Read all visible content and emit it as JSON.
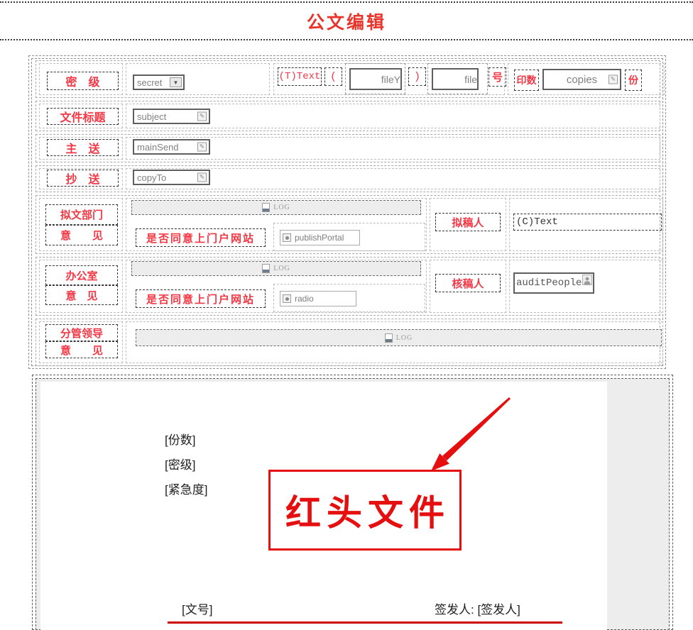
{
  "header": {
    "title": "公文编辑"
  },
  "form": {
    "secret": {
      "label": "密　级",
      "value": "secret"
    },
    "file_number": {
      "t_text": "(T)Text",
      "open_paren": "(",
      "year_value": "fileY",
      "close_paren": ")",
      "no_value": "file",
      "suffix": "号"
    },
    "print_count": {
      "label": "印数",
      "value": "copies",
      "unit": "份"
    },
    "subject": {
      "label": "文件标题",
      "value": "subject"
    },
    "main_send": {
      "label": "主　送",
      "value": "mainSend"
    },
    "copy_to": {
      "label": "抄　送",
      "value": "copyTo"
    },
    "draft_dept": {
      "label_line1": "拟文部门",
      "label_line2": "意　　见",
      "log": "LOG",
      "portal_question": "是否同意上门户网站",
      "portal_value": "publishPortal"
    },
    "drafter": {
      "label": "拟稿人",
      "value": "(C)Text"
    },
    "office": {
      "label_line1": "办公室",
      "label_line2": "意　见",
      "log": "LOG",
      "portal_question": "是否同意上门户网站",
      "portal_value": "radio"
    },
    "auditor": {
      "label": "核稿人",
      "value": "auditPeople"
    },
    "leader": {
      "label_line1": "分管领导",
      "label_line2": "意　　见",
      "log": "LOG"
    }
  },
  "preview": {
    "copies_field": "[份数]",
    "secret_field": "[密级]",
    "urgency_field": "[紧急度]",
    "stamp": "红头文件",
    "doc_number_field": "[文号]",
    "signer_line": "签发人: [签发人]"
  },
  "colors": {
    "title_red": "#e8342b",
    "label_red": "#f43744",
    "stamp_red": "#e60f0f",
    "line_red": "#cc0000"
  }
}
